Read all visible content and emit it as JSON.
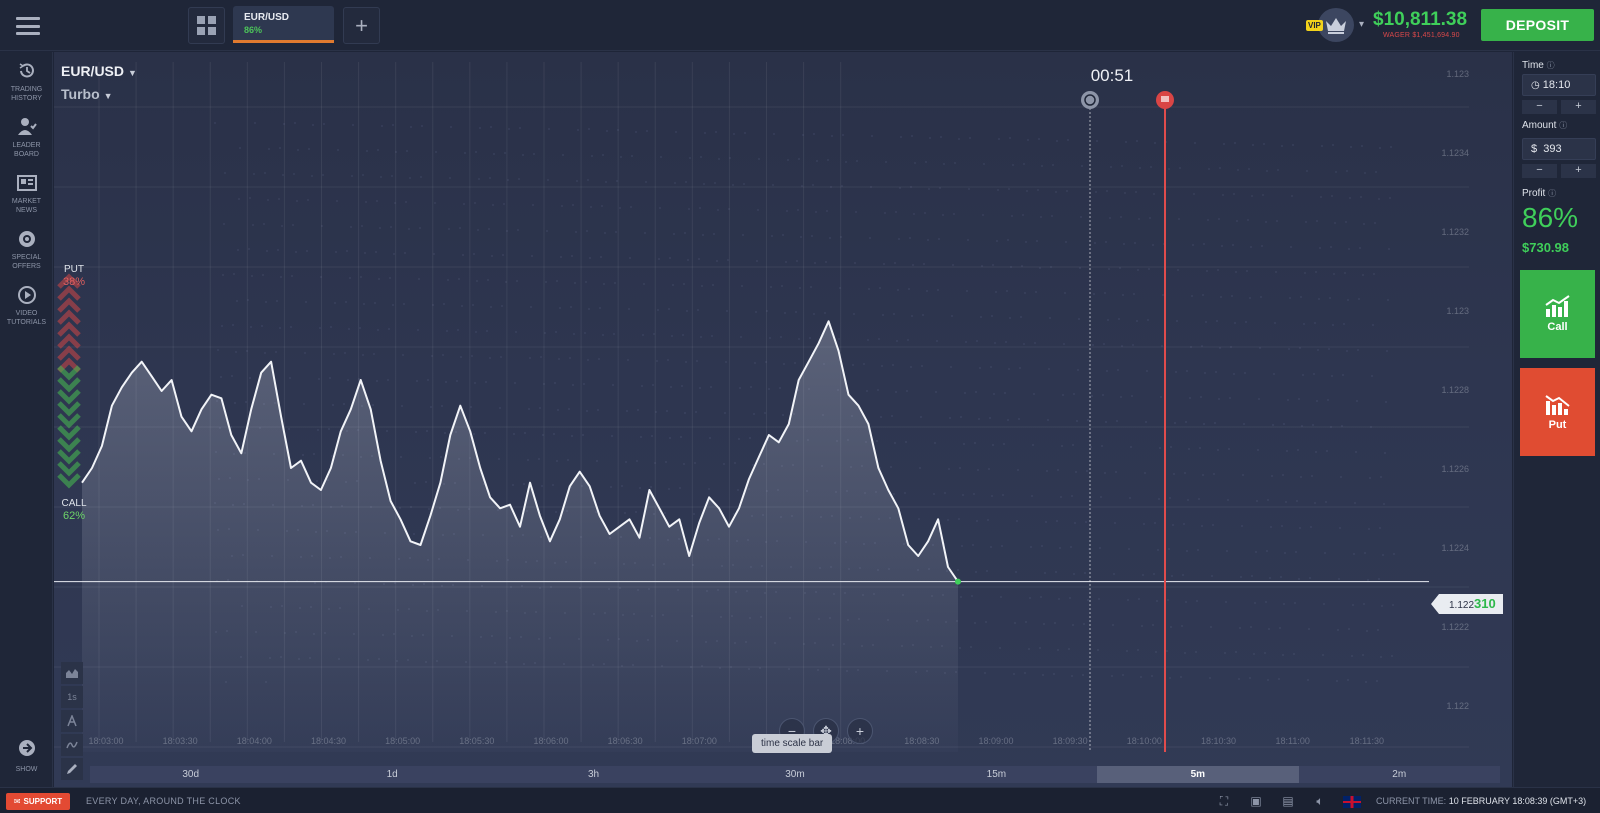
{
  "header": {
    "asset_tab": {
      "name": "EUR/USD",
      "percent": "86%"
    },
    "add_tab": "+",
    "vip_badge": "VIP",
    "balance": "$10,811.38",
    "wager": "WAGER $1,451,694.90",
    "deposit_label": "DEPOSIT"
  },
  "sidebar": {
    "items": [
      {
        "label_1": "TRADING",
        "label_2": "HISTORY",
        "icon": "history-icon"
      },
      {
        "label_1": "LEADER",
        "label_2": "BOARD",
        "icon": "leaderboard-icon"
      },
      {
        "label_1": "MARKET",
        "label_2": "NEWS",
        "icon": "news-icon"
      },
      {
        "label_1": "SPECIAL",
        "label_2": "OFFERS",
        "icon": "offers-icon"
      },
      {
        "label_1": "VIDEO",
        "label_2": "TUTORIALS",
        "icon": "play-icon"
      }
    ],
    "show_label": "SHOW"
  },
  "chart": {
    "pair": "EUR/USD",
    "mode": "Turbo",
    "timer": "00:51",
    "put_label": "PUT",
    "put_value": "38%",
    "call_label": "CALL",
    "call_value": "62%",
    "tooltip": "time scale bar",
    "zoom_minus": "−",
    "zoom_plus": "+",
    "current_price_prefix": "1.122",
    "current_price_highlight": "310",
    "timescale": [
      "30d",
      "1d",
      "3h",
      "30m",
      "15m",
      "5m",
      "2m"
    ],
    "timescale_active": "5m",
    "tools": [
      "1s"
    ]
  },
  "chart_data": {
    "type": "area",
    "y_ticks": [
      "1.123",
      "1.1234",
      "1.1232",
      "1.123",
      "1.1228",
      "1.1226",
      "1.1224",
      "1.1222",
      "1.122"
    ],
    "x_ticks": [
      "18:03:00",
      "18:03:30",
      "18:04:00",
      "18:04:30",
      "18:05:00",
      "18:05:30",
      "18:06:00",
      "18:06:30",
      "18:07:00",
      "18:07:30",
      "18:08:00",
      "18:08:30",
      "18:09:00",
      "18:09:30",
      "18:10:00",
      "18:10:30",
      "18:11:00",
      "18:11:30"
    ],
    "current_price": 1.12231,
    "ylim": [
      1.1219,
      1.1237
    ],
    "series": [
      {
        "values": [
          1.12258,
          1.12262,
          1.12268,
          1.12279,
          1.12284,
          1.12288,
          1.12291,
          1.12287,
          1.12283,
          1.12286,
          1.12276,
          1.12272,
          1.12278,
          1.12282,
          1.12281,
          1.12271,
          1.12266,
          1.12278,
          1.12288,
          1.12291,
          1.12276,
          1.12262,
          1.12264,
          1.12258,
          1.12256,
          1.12262,
          1.12272,
          1.12278,
          1.12286,
          1.12278,
          1.12264,
          1.12253,
          1.12248,
          1.12242,
          1.12241,
          1.12249,
          1.12258,
          1.12271,
          1.12279,
          1.12272,
          1.12262,
          1.12254,
          1.12251,
          1.12252,
          1.12246,
          1.12258,
          1.12249,
          1.12242,
          1.12248,
          1.12257,
          1.12261,
          1.12257,
          1.12249,
          1.12244,
          1.12246,
          1.12248,
          1.12243,
          1.12256,
          1.12251,
          1.12246,
          1.12248,
          1.12238,
          1.12247,
          1.12254,
          1.12251,
          1.12246,
          1.12251,
          1.12259,
          1.12265,
          1.12271,
          1.12269,
          1.12274,
          1.12286,
          1.12291,
          1.12296,
          1.12302,
          1.12294,
          1.12282,
          1.12279,
          1.12274,
          1.12262,
          1.12256,
          1.12251,
          1.12241,
          1.12238,
          1.12242,
          1.12248,
          1.12235,
          1.12231
        ]
      }
    ]
  },
  "right_panel": {
    "time_label": "Time",
    "time_value": "18:10",
    "amount_label": "Amount",
    "amount_currency": "$",
    "amount_value": "393",
    "minus": "−",
    "plus": "+",
    "profit_label": "Profit",
    "profit_pct": "86%",
    "profit_value": "$730.98",
    "call_label": "Call",
    "put_label": "Put"
  },
  "footer": {
    "support_label": "SUPPORT",
    "slogan": "EVERY DAY, AROUND THE CLOCK",
    "current_time_label": "CURRENT TIME:",
    "current_time_value": "10 FEBRUARY 18:08:39 (GMT+3)"
  },
  "colors": {
    "accent_green": "#37b24a",
    "accent_red": "#e04c32",
    "tab_underline": "#e07a2f",
    "background": "#1e2538"
  }
}
